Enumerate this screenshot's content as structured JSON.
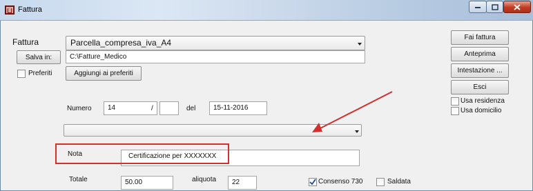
{
  "window": {
    "title": "Fattura"
  },
  "form": {
    "fattura_label": "Fattura",
    "template_select": "Parcella_compresa_iva_A4",
    "salva_in_button": "Salva in:",
    "save_path": "C:\\Fatture_Medico",
    "preferiti_label": "Preferiti",
    "aggiungi_button": "Aggiungi ai preferiti",
    "numero_label": "Numero",
    "numero_value": "14",
    "slash": "/",
    "numero_suffix": "",
    "del_label": "del",
    "date_value": "15-11-2016",
    "second_select": "",
    "nota_label": "Nota",
    "nota_value": "Certificazione per XXXXXXX",
    "totale_label": "Totale",
    "totale_value": "50.00",
    "aliquota_label": "aliquota",
    "aliquota_value": "22",
    "consenso_label": "Consenso 730",
    "consenso_checked": true,
    "saldata_label": "Saldata",
    "saldata_checked": false
  },
  "actions": {
    "fai_fattura": "Fai fattura",
    "anteprima": "Anteprima",
    "intestazione": "Intestazione ...",
    "esci": "Esci",
    "usa_residenza": "Usa residenza",
    "usa_domicilio": "Usa domicilio"
  },
  "annotations": {
    "highlight_color": "#d32f2f",
    "arrow_color": "#d32f2f"
  }
}
